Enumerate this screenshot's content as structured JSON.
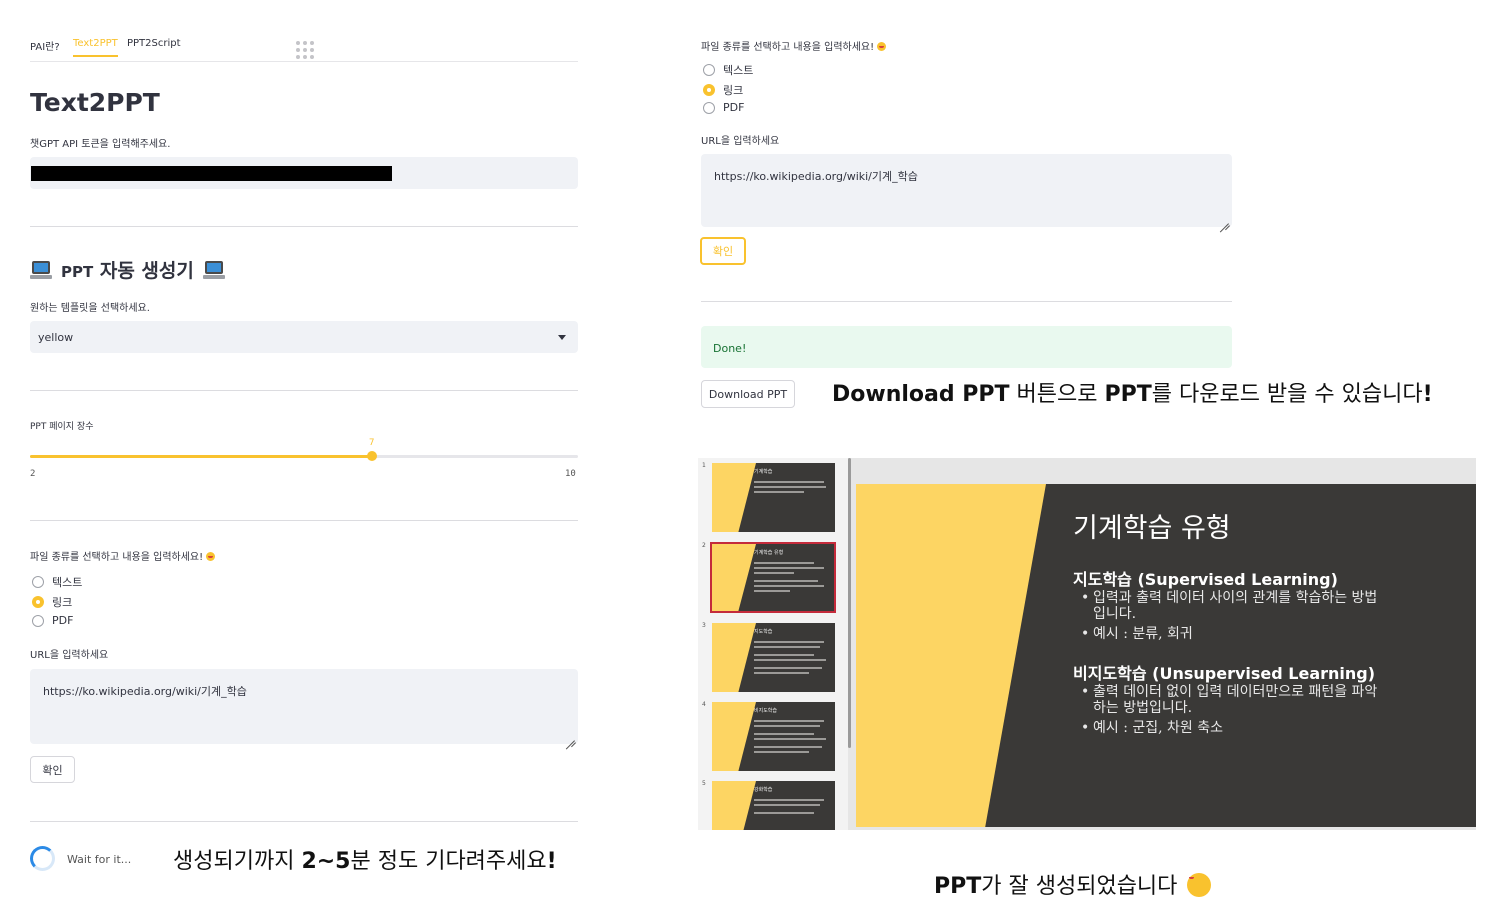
{
  "left": {
    "tabs": [
      "PAI란?",
      "Text2PPT",
      "PPT2Script"
    ],
    "active_tab": "Text2PPT",
    "title": "Text2PPT",
    "token_label": "챗GPT API 토큰을 입력해주세요.",
    "section_title": "PPT 자동 생성기",
    "section_title_ppt": "PPT",
    "section_title_rest": "자동 생성기",
    "template_label": "원하는 템플릿을 선택하세요.",
    "template_value": "yellow",
    "pages_label": "PPT 페이지 장수",
    "slider": {
      "min": "2",
      "max": "10",
      "value": "7",
      "fraction": 0.625
    },
    "filetype_label": "파일 종류를 선택하고 내용을 입력하세요!",
    "radio_options": [
      "텍스트",
      "링크",
      "PDF"
    ],
    "radio_selected": "링크",
    "url_label": "URL을 입력하세요",
    "url_value": "https://ko.wikipedia.org/wiki/기계_학습",
    "confirm_label": "확인",
    "wait_text": "Wait for it...",
    "caption_pre": "생성되기까지 ",
    "caption_bold": "2~5",
    "caption_post": "분 정도 기다려주세요",
    "caption_bang": "!"
  },
  "right": {
    "filetype_label": "파일 종류를 선택하고 내용을 입력하세요!",
    "radio_options": [
      "텍스트",
      "링크",
      "PDF"
    ],
    "radio_selected": "링크",
    "url_label": "URL을 입력하세요",
    "url_value": "https://ko.wikipedia.org/wiki/기계_학습",
    "confirm_label": "확인",
    "done_text": "Done!",
    "download_label": "Download PPT",
    "caption_b1": "Download PPT",
    "caption_t1": " 버튼으로 ",
    "caption_b2": "PPT",
    "caption_t2": "를 다운로드 받을 수 있습니다",
    "caption_bang": "!",
    "bottom_caption_b": "PPT",
    "bottom_caption_t": "가 잘 생성되었습니다"
  },
  "viewer": {
    "thumbnails": [
      {
        "num": "1",
        "title": "기계학습"
      },
      {
        "num": "2",
        "title": "기계학습 유형"
      },
      {
        "num": "3",
        "title": "지도학습"
      },
      {
        "num": "4",
        "title": "비지도학습"
      },
      {
        "num": "5",
        "title": "강화학습"
      }
    ],
    "slide": {
      "title": "기계학습 유형",
      "h1": "지도학습 (Supervised Learning)",
      "b1a": "입력과 출력 데이터 사이의 관계를 학습하는 방법",
      "b1b": "입니다.",
      "b1c": "예시 : 분류, 회귀",
      "h2": "비지도학습 (Unsupervised Learning)",
      "b2a": "출력 데이터 없이 입력 데이터만으로 패턴을 파악",
      "b2b": "하는 방법입니다.",
      "b2c": "예시 : 군집, 차원 축소"
    }
  },
  "colors": {
    "accent": "#f9c22e",
    "slide_dark": "#3a3937",
    "slide_yellow": "#fdd563",
    "success_bg": "#e9f9ef",
    "success_text": "#177233"
  },
  "icons": [
    "laptop-icon",
    "grin-emoji-icon",
    "smile-emoji-icon",
    "caret-down-icon",
    "spinner-icon",
    "resize-handle-icon",
    "grip-icon"
  ]
}
